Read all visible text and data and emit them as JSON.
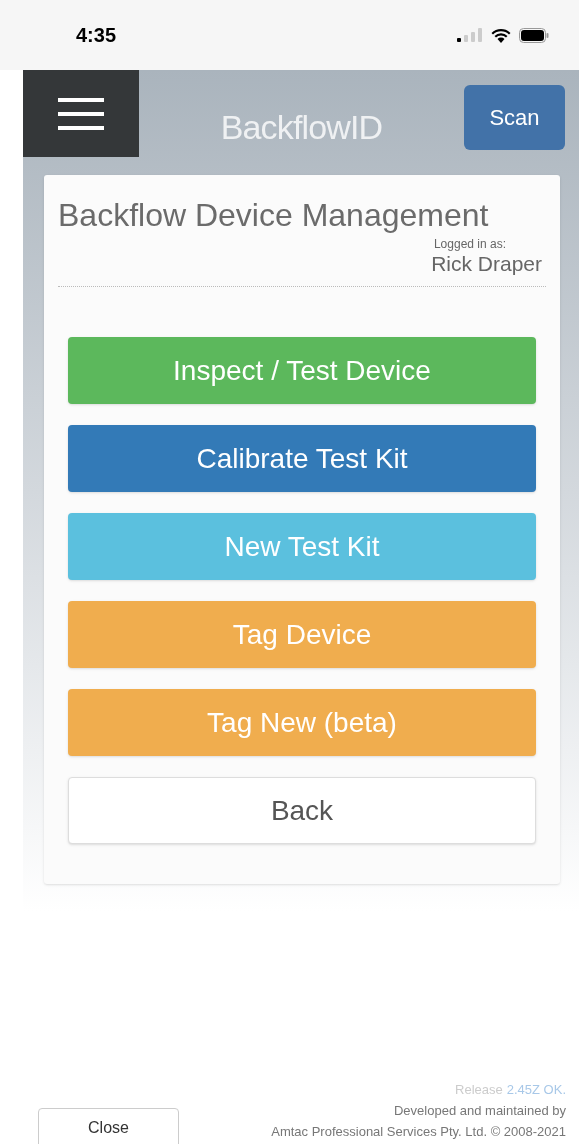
{
  "status_bar": {
    "time": "4:35"
  },
  "header": {
    "logo": "BackflowID",
    "scan_button": "Scan"
  },
  "card": {
    "title": "Backflow Device Management",
    "logged_in_label": "Logged in as:",
    "user": "Rick Draper",
    "buttons": [
      {
        "label": "Inspect / Test Device",
        "kind": "success"
      },
      {
        "label": "Calibrate Test Kit",
        "kind": "primary"
      },
      {
        "label": "New Test Kit",
        "kind": "info"
      },
      {
        "label": "Tag Device",
        "kind": "warning"
      },
      {
        "label": "Tag New (beta)",
        "kind": "warning"
      },
      {
        "label": "Back",
        "kind": "default"
      }
    ]
  },
  "footer": {
    "close_button": "Close",
    "release_label": "Release",
    "release_version": "2.45Z OK.",
    "developed_by": "Developed and maintained by",
    "company": "Amtac Professional Services Pty. Ltd. © 2008-2021"
  }
}
